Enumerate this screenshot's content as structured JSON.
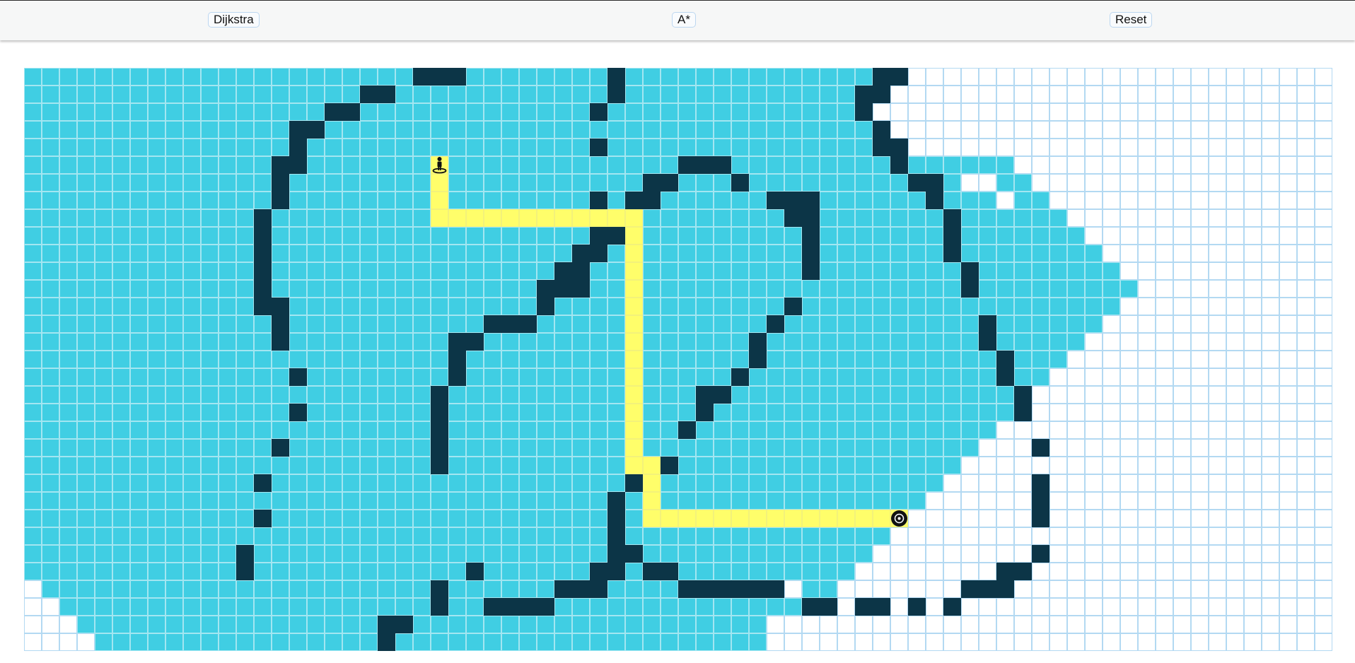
{
  "toolbar": {
    "buttons": [
      {
        "id": "dijkstra",
        "label": "Dijkstra"
      },
      {
        "id": "astar",
        "label": "A*"
      },
      {
        "id": "reset",
        "label": "Reset"
      }
    ]
  },
  "grid": {
    "rows": 33,
    "cols": 74,
    "start": {
      "row": 5,
      "col": 23
    },
    "target": {
      "row": 25,
      "col": 49
    },
    "colors": {
      "unvisited": "#ffffff",
      "unvisited_border": "#b3d9f2",
      "visited": "#40cee3",
      "visited_border": "#a3e6f1",
      "wall": "#0c3547",
      "path": "#fffe6a",
      "path_border": "#f3f27a"
    },
    "walls": [
      [
        0,
        22
      ],
      [
        0,
        23
      ],
      [
        0,
        24
      ],
      [
        0,
        33
      ],
      [
        0,
        48
      ],
      [
        0,
        49
      ],
      [
        1,
        19
      ],
      [
        1,
        20
      ],
      [
        1,
        33
      ],
      [
        1,
        47
      ],
      [
        1,
        48
      ],
      [
        2,
        17
      ],
      [
        2,
        18
      ],
      [
        2,
        32
      ],
      [
        2,
        47
      ],
      [
        3,
        15
      ],
      [
        3,
        16
      ],
      [
        3,
        48
      ],
      [
        4,
        15
      ],
      [
        4,
        32
      ],
      [
        4,
        48
      ],
      [
        4,
        49
      ],
      [
        5,
        14
      ],
      [
        5,
        15
      ],
      [
        5,
        37
      ],
      [
        5,
        38
      ],
      [
        5,
        39
      ],
      [
        5,
        49
      ],
      [
        6,
        14
      ],
      [
        6,
        35
      ],
      [
        6,
        36
      ],
      [
        6,
        40
      ],
      [
        6,
        50
      ],
      [
        6,
        51
      ],
      [
        7,
        14
      ],
      [
        7,
        32
      ],
      [
        7,
        34
      ],
      [
        7,
        35
      ],
      [
        7,
        42
      ],
      [
        7,
        43
      ],
      [
        7,
        44
      ],
      [
        7,
        51
      ],
      [
        8,
        13
      ],
      [
        8,
        43
      ],
      [
        8,
        44
      ],
      [
        8,
        52
      ],
      [
        9,
        13
      ],
      [
        9,
        32
      ],
      [
        9,
        33
      ],
      [
        9,
        44
      ],
      [
        9,
        52
      ],
      [
        10,
        13
      ],
      [
        10,
        31
      ],
      [
        10,
        32
      ],
      [
        10,
        44
      ],
      [
        10,
        52
      ],
      [
        11,
        13
      ],
      [
        11,
        30
      ],
      [
        11,
        31
      ],
      [
        11,
        44
      ],
      [
        11,
        53
      ],
      [
        12,
        13
      ],
      [
        12,
        29
      ],
      [
        12,
        30
      ],
      [
        12,
        31
      ],
      [
        12,
        53
      ],
      [
        13,
        13
      ],
      [
        13,
        14
      ],
      [
        13,
        29
      ],
      [
        13,
        43
      ],
      [
        14,
        14
      ],
      [
        14,
        26
      ],
      [
        14,
        27
      ],
      [
        14,
        28
      ],
      [
        14,
        42
      ],
      [
        14,
        54
      ],
      [
        15,
        14
      ],
      [
        15,
        24
      ],
      [
        15,
        25
      ],
      [
        15,
        41
      ],
      [
        15,
        54
      ],
      [
        16,
        24
      ],
      [
        16,
        41
      ],
      [
        16,
        55
      ],
      [
        17,
        15
      ],
      [
        17,
        24
      ],
      [
        17,
        40
      ],
      [
        17,
        55
      ],
      [
        18,
        23
      ],
      [
        18,
        38
      ],
      [
        18,
        39
      ],
      [
        18,
        56
      ],
      [
        19,
        15
      ],
      [
        19,
        23
      ],
      [
        19,
        38
      ],
      [
        19,
        56
      ],
      [
        20,
        23
      ],
      [
        20,
        37
      ],
      [
        21,
        14
      ],
      [
        21,
        23
      ],
      [
        21,
        57
      ],
      [
        22,
        23
      ],
      [
        22,
        36
      ],
      [
        23,
        13
      ],
      [
        23,
        34
      ],
      [
        23,
        57
      ],
      [
        24,
        33
      ],
      [
        24,
        57
      ],
      [
        25,
        13
      ],
      [
        25,
        33
      ],
      [
        25,
        57
      ],
      [
        26,
        33
      ],
      [
        27,
        12
      ],
      [
        27,
        33
      ],
      [
        27,
        34
      ],
      [
        27,
        57
      ],
      [
        28,
        12
      ],
      [
        28,
        25
      ],
      [
        28,
        32
      ],
      [
        28,
        33
      ],
      [
        28,
        35
      ],
      [
        28,
        36
      ],
      [
        28,
        55
      ],
      [
        28,
        56
      ],
      [
        29,
        23
      ],
      [
        29,
        30
      ],
      [
        29,
        31
      ],
      [
        29,
        32
      ],
      [
        29,
        37
      ],
      [
        29,
        38
      ],
      [
        29,
        39
      ],
      [
        29,
        40
      ],
      [
        29,
        41
      ],
      [
        29,
        42
      ],
      [
        29,
        53
      ],
      [
        29,
        54
      ],
      [
        29,
        55
      ],
      [
        30,
        23
      ],
      [
        30,
        26
      ],
      [
        30,
        27
      ],
      [
        30,
        28
      ],
      [
        30,
        29
      ],
      [
        30,
        44
      ],
      [
        30,
        45
      ],
      [
        30,
        47
      ],
      [
        30,
        48
      ],
      [
        30,
        50
      ],
      [
        30,
        52
      ],
      [
        31,
        20
      ],
      [
        31,
        21
      ],
      [
        32,
        20
      ]
    ],
    "path": [
      [
        5,
        23
      ],
      [
        6,
        23
      ],
      [
        7,
        23
      ],
      [
        8,
        23
      ],
      [
        8,
        24
      ],
      [
        8,
        25
      ],
      [
        8,
        26
      ],
      [
        8,
        27
      ],
      [
        8,
        28
      ],
      [
        8,
        29
      ],
      [
        8,
        30
      ],
      [
        8,
        31
      ],
      [
        8,
        32
      ],
      [
        8,
        33
      ],
      [
        8,
        34
      ],
      [
        9,
        34
      ],
      [
        10,
        34
      ],
      [
        11,
        34
      ],
      [
        12,
        34
      ],
      [
        13,
        34
      ],
      [
        14,
        34
      ],
      [
        15,
        34
      ],
      [
        16,
        34
      ],
      [
        17,
        34
      ],
      [
        18,
        34
      ],
      [
        19,
        34
      ],
      [
        20,
        34
      ],
      [
        21,
        34
      ],
      [
        22,
        34
      ],
      [
        22,
        35
      ],
      [
        23,
        35
      ],
      [
        24,
        35
      ],
      [
        25,
        35
      ],
      [
        25,
        36
      ],
      [
        25,
        37
      ],
      [
        25,
        38
      ],
      [
        25,
        39
      ],
      [
        25,
        40
      ],
      [
        25,
        41
      ],
      [
        25,
        42
      ],
      [
        25,
        43
      ],
      [
        25,
        44
      ],
      [
        25,
        45
      ],
      [
        25,
        46
      ],
      [
        25,
        47
      ],
      [
        25,
        48
      ],
      [
        25,
        49
      ]
    ]
  }
}
